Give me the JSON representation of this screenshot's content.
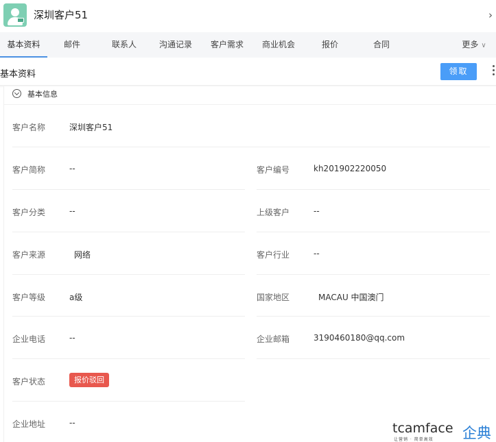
{
  "header": {
    "title": "深圳客户51",
    "avatar_icon": "customer-avatar-icon",
    "close_icon": "chevron-right-icon"
  },
  "tabs": [
    {
      "label": "基本资料",
      "active": true
    },
    {
      "label": "邮件"
    },
    {
      "label": "联系人"
    },
    {
      "label": "沟通记录"
    },
    {
      "label": "客户需求"
    },
    {
      "label": "商业机会"
    },
    {
      "label": "报价"
    },
    {
      "label": "合同"
    },
    {
      "label": "更多"
    }
  ],
  "section": {
    "title": "基本资料",
    "claim_label": "领取",
    "claim_color": "#4a9df8"
  },
  "group": {
    "label": "基本信息"
  },
  "fields": {
    "customer_name": {
      "label": "客户名称",
      "value": "深圳客户51"
    },
    "short_name": {
      "label": "客户简称",
      "value": "--"
    },
    "customer_no": {
      "label": "客户编号",
      "value": "kh201902220050"
    },
    "category": {
      "label": "客户分类",
      "value": "--"
    },
    "parent": {
      "label": "上级客户",
      "value": "--"
    },
    "source": {
      "label": "客户来源",
      "value": "网络"
    },
    "industry": {
      "label": "客户行业",
      "value": "--"
    },
    "level": {
      "label": "客户等级",
      "value": "a级"
    },
    "region": {
      "label": "国家地区",
      "value": "MACAU 中国澳门"
    },
    "phone": {
      "label": "企业电话",
      "value": "--"
    },
    "email": {
      "label": "企业邮箱",
      "value": "3190460180@qq.com"
    },
    "status": {
      "label": "客户状态",
      "value": "报价驳回",
      "color": "#e8584e"
    },
    "address": {
      "label": "企业地址",
      "value": "--"
    }
  },
  "watermark": {
    "brand_en": "tcamface",
    "brand_cn": "企典",
    "slogan": "让营销 · 简单高效"
  }
}
